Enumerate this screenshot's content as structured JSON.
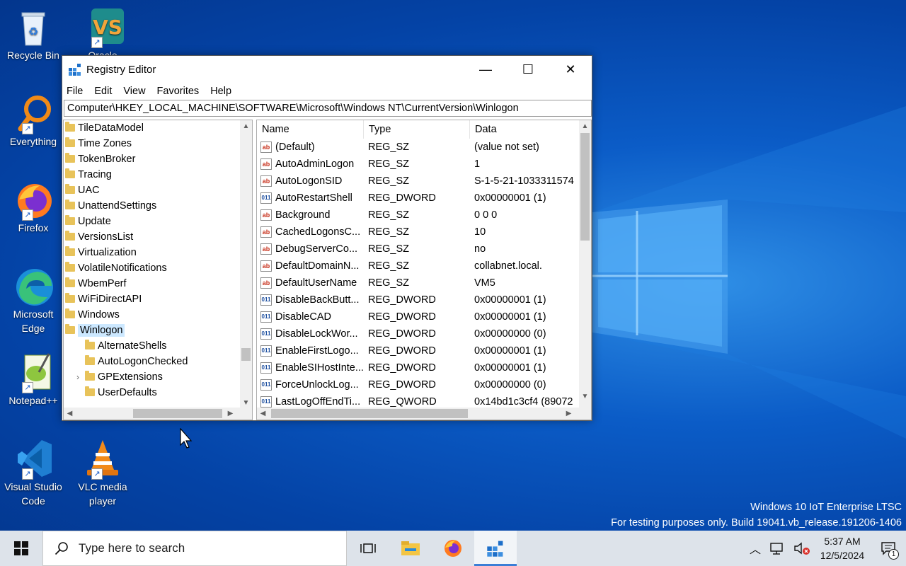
{
  "desktop": {
    "icons": [
      {
        "label": "Recycle Bin"
      },
      {
        "label": "Oracle"
      },
      {
        "label": "Everything"
      },
      {
        "label": "Firefox"
      },
      {
        "label": "Microsoft Edge"
      },
      {
        "label": "Notepad++"
      },
      {
        "label": "Visual Studio Code"
      },
      {
        "label": "VLC media player"
      }
    ],
    "watermark": {
      "line1": "Windows 10 IoT Enterprise LTSC",
      "line2": "For testing purposes only. Build 19041.vb_release.191206-1406"
    }
  },
  "window": {
    "title": "Registry Editor",
    "buttons": {
      "minimize": "—",
      "maximize": "☐",
      "close": "✕"
    },
    "menu": [
      "File",
      "Edit",
      "View",
      "Favorites",
      "Help"
    ],
    "address": "Computer\\HKEY_LOCAL_MACHINE\\SOFTWARE\\Microsoft\\Windows NT\\CurrentVersion\\Winlogon",
    "tree": [
      {
        "label": "TileDataModel"
      },
      {
        "label": "Time Zones"
      },
      {
        "label": "TokenBroker"
      },
      {
        "label": "Tracing"
      },
      {
        "label": "UAC"
      },
      {
        "label": "UnattendSettings"
      },
      {
        "label": "Update"
      },
      {
        "label": "VersionsList"
      },
      {
        "label": "Virtualization"
      },
      {
        "label": "VolatileNotifications"
      },
      {
        "label": "WbemPerf"
      },
      {
        "label": "WiFiDirectAPI"
      },
      {
        "label": "Windows"
      },
      {
        "label": "Winlogon"
      },
      {
        "label": "AlternateShells"
      },
      {
        "label": "AutoLogonChecked"
      },
      {
        "label": "GPExtensions"
      },
      {
        "label": "UserDefaults"
      }
    ],
    "columns": {
      "name": "Name",
      "type": "Type",
      "data": "Data"
    },
    "rows": [
      {
        "name": "(Default)",
        "type": "REG_SZ",
        "data": "(value not set)",
        "icon": "ab"
      },
      {
        "name": "AutoAdminLogon",
        "type": "REG_SZ",
        "data": "1",
        "icon": "ab"
      },
      {
        "name": "AutoLogonSID",
        "type": "REG_SZ",
        "data": "S-1-5-21-1033311574",
        "icon": "ab"
      },
      {
        "name": "AutoRestartShell",
        "type": "REG_DWORD",
        "data": "0x00000001 (1)",
        "icon": "011"
      },
      {
        "name": "Background",
        "type": "REG_SZ",
        "data": "0 0 0",
        "icon": "ab"
      },
      {
        "name": "CachedLogonsC...",
        "type": "REG_SZ",
        "data": "10",
        "icon": "ab"
      },
      {
        "name": "DebugServerCo...",
        "type": "REG_SZ",
        "data": "no",
        "icon": "ab"
      },
      {
        "name": "DefaultDomainN...",
        "type": "REG_SZ",
        "data": "collabnet.local.",
        "icon": "ab"
      },
      {
        "name": "DefaultUserName",
        "type": "REG_SZ",
        "data": "VM5",
        "icon": "ab"
      },
      {
        "name": "DisableBackButt...",
        "type": "REG_DWORD",
        "data": "0x00000001 (1)",
        "icon": "011"
      },
      {
        "name": "DisableCAD",
        "type": "REG_DWORD",
        "data": "0x00000001 (1)",
        "icon": "011"
      },
      {
        "name": "DisableLockWor...",
        "type": "REG_DWORD",
        "data": "0x00000000 (0)",
        "icon": "011"
      },
      {
        "name": "EnableFirstLogo...",
        "type": "REG_DWORD",
        "data": "0x00000001 (1)",
        "icon": "011"
      },
      {
        "name": "EnableSIHostInte...",
        "type": "REG_DWORD",
        "data": "0x00000001 (1)",
        "icon": "011"
      },
      {
        "name": "ForceUnlockLog...",
        "type": "REG_DWORD",
        "data": "0x00000000 (0)",
        "icon": "011"
      },
      {
        "name": "LastLogOffEndTi...",
        "type": "REG_QWORD",
        "data": "0x14bd1c3cf4 (89072",
        "icon": "011"
      }
    ]
  },
  "taskbar": {
    "search_placeholder": "Type here to search",
    "time": "5:37 AM",
    "date": "12/5/2024",
    "notification_count": "1"
  },
  "colors": {
    "accent": "#3a7ed6",
    "selection": "#cce8ff",
    "taskbar": "#dde3ea"
  }
}
